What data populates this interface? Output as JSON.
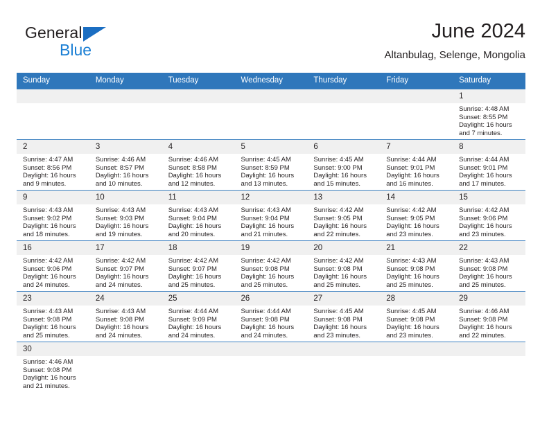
{
  "brand": {
    "name_top": "General",
    "name_bottom": "Blue",
    "triangle_color": "#1b6ec2",
    "blue_color": "#1b7fd4"
  },
  "header": {
    "title": "June 2024",
    "subtitle": "Altanbulag, Selenge, Mongolia"
  },
  "theme": {
    "header_row_bg": "#2f77bb",
    "daynum_bg": "#f0f0f0",
    "row_border": "#3a7fc0",
    "text": "#231f20"
  },
  "weekdays": [
    "Sunday",
    "Monday",
    "Tuesday",
    "Wednesday",
    "Thursday",
    "Friday",
    "Saturday"
  ],
  "labels": {
    "sunrise": "Sunrise:",
    "sunset": "Sunset:",
    "daylight": "Daylight:"
  },
  "weeks": [
    [
      {
        "day": "",
        "blank": true
      },
      {
        "day": "",
        "blank": true
      },
      {
        "day": "",
        "blank": true
      },
      {
        "day": "",
        "blank": true
      },
      {
        "day": "",
        "blank": true
      },
      {
        "day": "",
        "blank": true
      },
      {
        "day": "1",
        "sunrise": "Sunrise: 4:48 AM",
        "sunset": "Sunset: 8:55 PM",
        "daylight_1": "Daylight: 16 hours",
        "daylight_2": "and 7 minutes."
      }
    ],
    [
      {
        "day": "2",
        "sunrise": "Sunrise: 4:47 AM",
        "sunset": "Sunset: 8:56 PM",
        "daylight_1": "Daylight: 16 hours",
        "daylight_2": "and 9 minutes."
      },
      {
        "day": "3",
        "sunrise": "Sunrise: 4:46 AM",
        "sunset": "Sunset: 8:57 PM",
        "daylight_1": "Daylight: 16 hours",
        "daylight_2": "and 10 minutes."
      },
      {
        "day": "4",
        "sunrise": "Sunrise: 4:46 AM",
        "sunset": "Sunset: 8:58 PM",
        "daylight_1": "Daylight: 16 hours",
        "daylight_2": "and 12 minutes."
      },
      {
        "day": "5",
        "sunrise": "Sunrise: 4:45 AM",
        "sunset": "Sunset: 8:59 PM",
        "daylight_1": "Daylight: 16 hours",
        "daylight_2": "and 13 minutes."
      },
      {
        "day": "6",
        "sunrise": "Sunrise: 4:45 AM",
        "sunset": "Sunset: 9:00 PM",
        "daylight_1": "Daylight: 16 hours",
        "daylight_2": "and 15 minutes."
      },
      {
        "day": "7",
        "sunrise": "Sunrise: 4:44 AM",
        "sunset": "Sunset: 9:01 PM",
        "daylight_1": "Daylight: 16 hours",
        "daylight_2": "and 16 minutes."
      },
      {
        "day": "8",
        "sunrise": "Sunrise: 4:44 AM",
        "sunset": "Sunset: 9:01 PM",
        "daylight_1": "Daylight: 16 hours",
        "daylight_2": "and 17 minutes."
      }
    ],
    [
      {
        "day": "9",
        "sunrise": "Sunrise: 4:43 AM",
        "sunset": "Sunset: 9:02 PM",
        "daylight_1": "Daylight: 16 hours",
        "daylight_2": "and 18 minutes."
      },
      {
        "day": "10",
        "sunrise": "Sunrise: 4:43 AM",
        "sunset": "Sunset: 9:03 PM",
        "daylight_1": "Daylight: 16 hours",
        "daylight_2": "and 19 minutes."
      },
      {
        "day": "11",
        "sunrise": "Sunrise: 4:43 AM",
        "sunset": "Sunset: 9:04 PM",
        "daylight_1": "Daylight: 16 hours",
        "daylight_2": "and 20 minutes."
      },
      {
        "day": "12",
        "sunrise": "Sunrise: 4:43 AM",
        "sunset": "Sunset: 9:04 PM",
        "daylight_1": "Daylight: 16 hours",
        "daylight_2": "and 21 minutes."
      },
      {
        "day": "13",
        "sunrise": "Sunrise: 4:42 AM",
        "sunset": "Sunset: 9:05 PM",
        "daylight_1": "Daylight: 16 hours",
        "daylight_2": "and 22 minutes."
      },
      {
        "day": "14",
        "sunrise": "Sunrise: 4:42 AM",
        "sunset": "Sunset: 9:05 PM",
        "daylight_1": "Daylight: 16 hours",
        "daylight_2": "and 23 minutes."
      },
      {
        "day": "15",
        "sunrise": "Sunrise: 4:42 AM",
        "sunset": "Sunset: 9:06 PM",
        "daylight_1": "Daylight: 16 hours",
        "daylight_2": "and 23 minutes."
      }
    ],
    [
      {
        "day": "16",
        "sunrise": "Sunrise: 4:42 AM",
        "sunset": "Sunset: 9:06 PM",
        "daylight_1": "Daylight: 16 hours",
        "daylight_2": "and 24 minutes."
      },
      {
        "day": "17",
        "sunrise": "Sunrise: 4:42 AM",
        "sunset": "Sunset: 9:07 PM",
        "daylight_1": "Daylight: 16 hours",
        "daylight_2": "and 24 minutes."
      },
      {
        "day": "18",
        "sunrise": "Sunrise: 4:42 AM",
        "sunset": "Sunset: 9:07 PM",
        "daylight_1": "Daylight: 16 hours",
        "daylight_2": "and 25 minutes."
      },
      {
        "day": "19",
        "sunrise": "Sunrise: 4:42 AM",
        "sunset": "Sunset: 9:08 PM",
        "daylight_1": "Daylight: 16 hours",
        "daylight_2": "and 25 minutes."
      },
      {
        "day": "20",
        "sunrise": "Sunrise: 4:42 AM",
        "sunset": "Sunset: 9:08 PM",
        "daylight_1": "Daylight: 16 hours",
        "daylight_2": "and 25 minutes."
      },
      {
        "day": "21",
        "sunrise": "Sunrise: 4:43 AM",
        "sunset": "Sunset: 9:08 PM",
        "daylight_1": "Daylight: 16 hours",
        "daylight_2": "and 25 minutes."
      },
      {
        "day": "22",
        "sunrise": "Sunrise: 4:43 AM",
        "sunset": "Sunset: 9:08 PM",
        "daylight_1": "Daylight: 16 hours",
        "daylight_2": "and 25 minutes."
      }
    ],
    [
      {
        "day": "23",
        "sunrise": "Sunrise: 4:43 AM",
        "sunset": "Sunset: 9:08 PM",
        "daylight_1": "Daylight: 16 hours",
        "daylight_2": "and 25 minutes."
      },
      {
        "day": "24",
        "sunrise": "Sunrise: 4:43 AM",
        "sunset": "Sunset: 9:08 PM",
        "daylight_1": "Daylight: 16 hours",
        "daylight_2": "and 24 minutes."
      },
      {
        "day": "25",
        "sunrise": "Sunrise: 4:44 AM",
        "sunset": "Sunset: 9:09 PM",
        "daylight_1": "Daylight: 16 hours",
        "daylight_2": "and 24 minutes."
      },
      {
        "day": "26",
        "sunrise": "Sunrise: 4:44 AM",
        "sunset": "Sunset: 9:08 PM",
        "daylight_1": "Daylight: 16 hours",
        "daylight_2": "and 24 minutes."
      },
      {
        "day": "27",
        "sunrise": "Sunrise: 4:45 AM",
        "sunset": "Sunset: 9:08 PM",
        "daylight_1": "Daylight: 16 hours",
        "daylight_2": "and 23 minutes."
      },
      {
        "day": "28",
        "sunrise": "Sunrise: 4:45 AM",
        "sunset": "Sunset: 9:08 PM",
        "daylight_1": "Daylight: 16 hours",
        "daylight_2": "and 23 minutes."
      },
      {
        "day": "29",
        "sunrise": "Sunrise: 4:46 AM",
        "sunset": "Sunset: 9:08 PM",
        "daylight_1": "Daylight: 16 hours",
        "daylight_2": "and 22 minutes."
      }
    ],
    [
      {
        "day": "30",
        "sunrise": "Sunrise: 4:46 AM",
        "sunset": "Sunset: 9:08 PM",
        "daylight_1": "Daylight: 16 hours",
        "daylight_2": "and 21 minutes."
      },
      {
        "day": "",
        "blank": true
      },
      {
        "day": "",
        "blank": true
      },
      {
        "day": "",
        "blank": true
      },
      {
        "day": "",
        "blank": true
      },
      {
        "day": "",
        "blank": true
      },
      {
        "day": "",
        "blank": true
      }
    ]
  ]
}
